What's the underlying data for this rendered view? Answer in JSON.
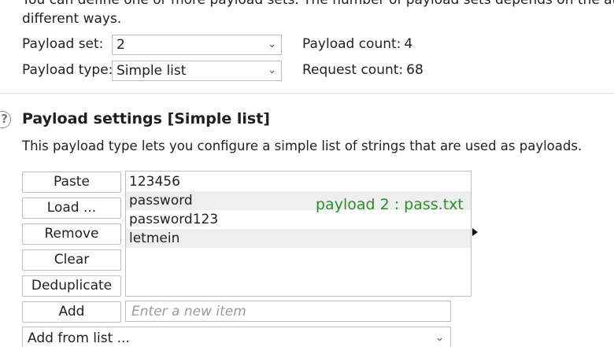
{
  "intro": {
    "line1": "You can define one or more payload sets. The number of payload sets depends on the attack type",
    "line2": "different ways."
  },
  "payload_set": {
    "label": "Payload set:",
    "value": "2"
  },
  "payload_type": {
    "label": "Payload type:",
    "value": "Simple list"
  },
  "payload_count": {
    "label": "Payload count:",
    "value": "4"
  },
  "request_count": {
    "label": "Request count:",
    "value": "68"
  },
  "settings": {
    "help_icon": "question-circle-icon",
    "title": "Payload settings [Simple list]",
    "description": "This payload type lets you configure a simple list of strings that are used as payloads."
  },
  "buttons": {
    "paste": "Paste",
    "load": "Load ...",
    "remove": "Remove",
    "clear": "Clear",
    "deduplicate": "Deduplicate",
    "add": "Add"
  },
  "payload_list": [
    "123456",
    "password",
    "password123",
    "letmein"
  ],
  "annotation": "payload 2 : pass.txt",
  "new_item": {
    "placeholder": "Enter a new item",
    "value": ""
  },
  "add_from_list": {
    "label": "Add from list ..."
  },
  "colors": {
    "annotation": "#2e8b2e",
    "row_alt": "#eeeeee"
  }
}
